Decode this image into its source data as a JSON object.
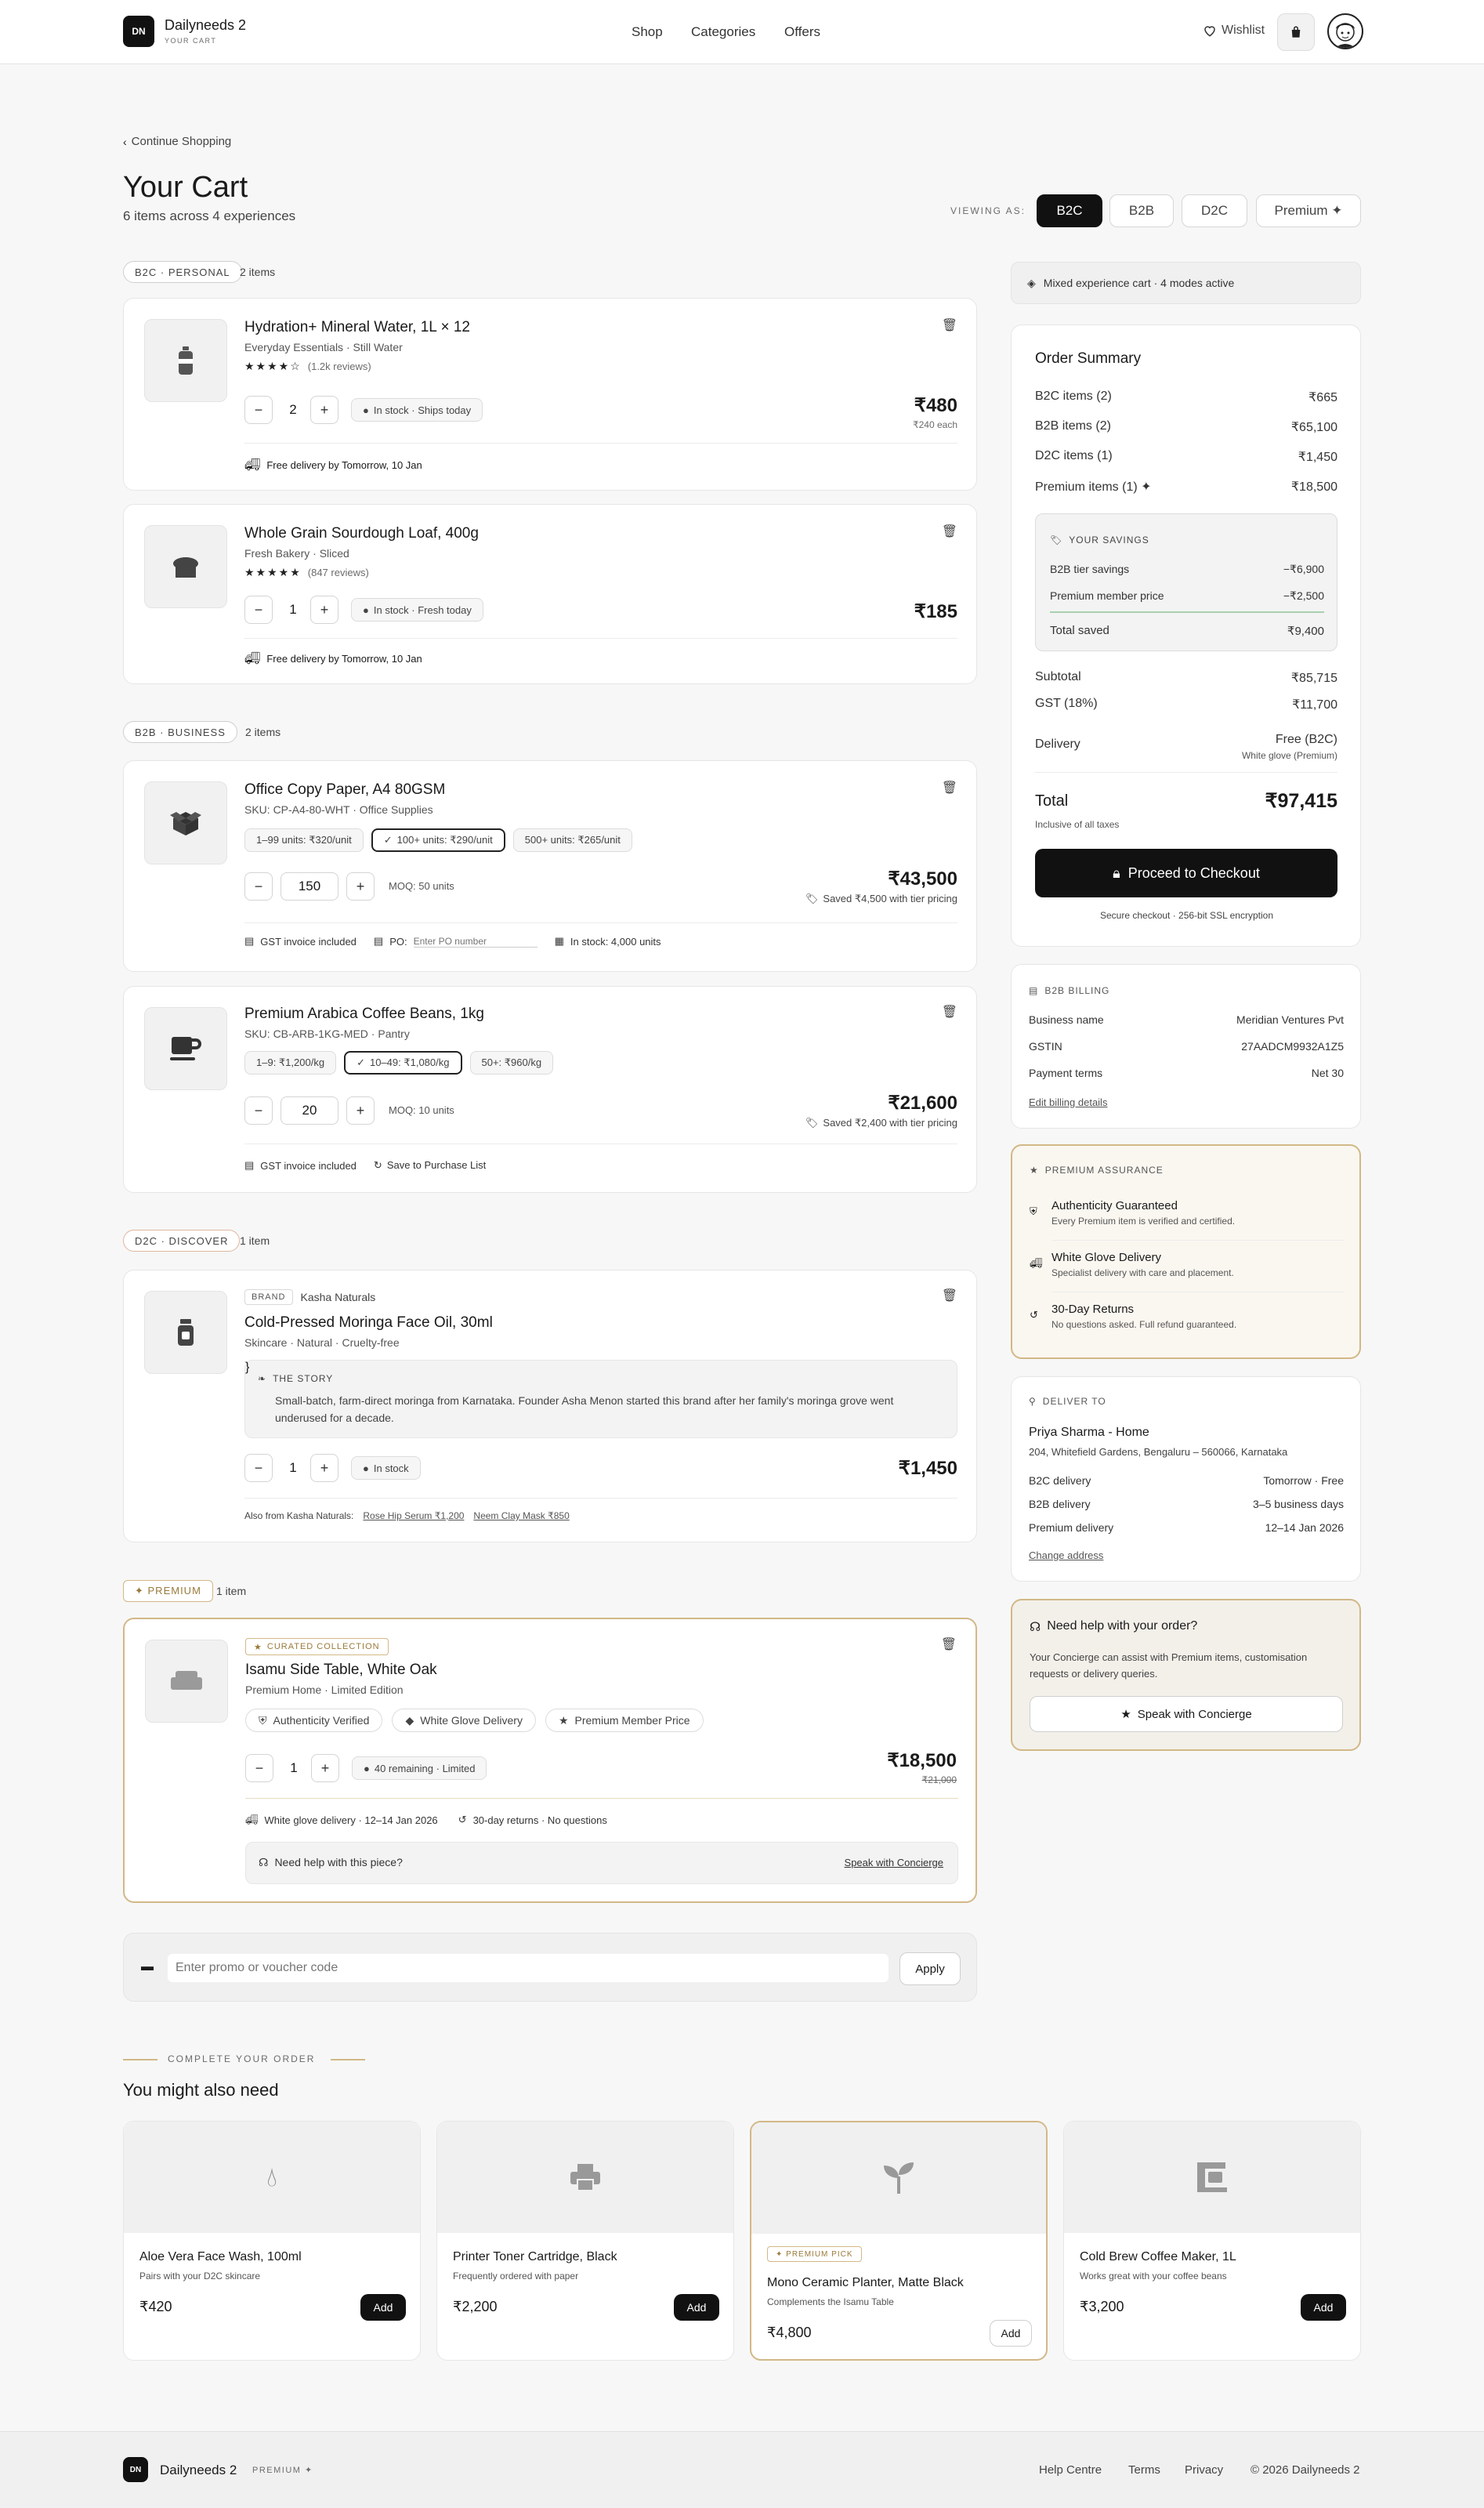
{
  "brand": {
    "initials": "DN",
    "name": "Dailyneeds 2",
    "sub": "YOUR CART"
  },
  "nav": [
    "Shop",
    "Categories",
    "Offers"
  ],
  "header": {
    "wishlist": "Wishlist"
  },
  "back": "Continue Shopping",
  "page": {
    "title": "Your Cart",
    "subtitle": "6 items across 4 experiences"
  },
  "viewing": {
    "label": "VIEWING AS:",
    "modes": [
      "B2C",
      "B2B",
      "D2C",
      "Premium ✦"
    ],
    "active": "B2C"
  },
  "sections": {
    "b2c": {
      "tag": "B2C · PERSONAL",
      "count": "2 items"
    },
    "b2b": {
      "tag": "B2B · BUSINESS",
      "count": "2 items"
    },
    "d2c": {
      "tag": "D2C · DISCOVER",
      "count": "1 item"
    },
    "prem": {
      "tag": "✦ PREMIUM",
      "count": "1 item"
    }
  },
  "items": {
    "water": {
      "name": "Hydration+ Mineral Water, 1L × 12",
      "meta": "Everyday Essentials · Still Water",
      "stars": "★★★★☆",
      "reviews": "(1.2k reviews)",
      "qty": "2",
      "stock": "In stock · Ships today",
      "price": "₹480",
      "unit": "₹240 each",
      "delivery": "Free delivery by Tomorrow, 10 Jan"
    },
    "bread": {
      "name": "Whole Grain Sourdough Loaf, 400g",
      "meta": "Fresh Bakery · Sliced",
      "stars": "★★★★★",
      "reviews": "(847 reviews)",
      "qty": "1",
      "stock": "In stock · Fresh today",
      "price": "₹185",
      "delivery": "Free delivery by Tomorrow, 10 Jan"
    },
    "paper": {
      "name": "Office Copy Paper, A4 80GSM",
      "meta": "SKU: CP-A4-80-WHT · Office Supplies",
      "tiers": [
        "1–99 units: ₹320/unit",
        "100+ units: ₹290/unit",
        "500+ units: ₹265/unit"
      ],
      "qty": "150",
      "moq": "MOQ: 50 units",
      "price": "₹43,500",
      "saved": "Saved ₹4,500 with tier pricing",
      "gst": "GST invoice included",
      "po_label": "PO:",
      "po_placeholder": "Enter PO number",
      "instock": "In stock: 4,000 units"
    },
    "coffee": {
      "name": "Premium Arabica Coffee Beans, 1kg",
      "meta": "SKU: CB-ARB-1KG-MED · Pantry",
      "tiers": [
        "1–9: ₹1,200/kg",
        "10–49: ₹1,080/kg",
        "50+: ₹960/kg"
      ],
      "qty": "20",
      "moq": "MOQ: 10 units",
      "price": "₹21,600",
      "saved": "Saved ₹2,400 with tier pricing",
      "gst": "GST invoice included",
      "save_list": "Save to Purchase List"
    },
    "oil": {
      "brand_tag": "BRAND",
      "brand": "Kasha Naturals",
      "name": "Cold-Pressed Moringa Face Oil, 30ml",
      "meta": "Skincare · Natural · Cruelty-free",
      "story_title": "THE STORY",
      "story": "Small-batch, farm-direct moringa from Karnataka. Founder Asha Menon started this brand after her family's moringa grove went underused for a decade.",
      "qty": "1",
      "stock": "In stock",
      "price": "₹1,450",
      "also_label": "Also from Kasha Naturals:",
      "also": [
        "Rose Hip Serum ₹1,200",
        "Neem Clay Mask ₹850"
      ]
    },
    "table": {
      "curated": "CURATED COLLECTION",
      "name": "Isamu Side Table, White Oak",
      "meta": "Premium Home · Limited Edition",
      "badges": [
        "Authenticity Verified",
        "White Glove Delivery",
        "Premium Member Price"
      ],
      "qty": "1",
      "stock": "40 remaining · Limited",
      "price": "₹18,500",
      "old_price": "₹21,000",
      "delivery": "White glove delivery · 12–14 Jan 2026",
      "returns": "30-day returns · No questions",
      "help": "Need help with this piece?",
      "help_link": "Speak with Concierge"
    }
  },
  "promo": {
    "placeholder": "Enter promo or voucher code",
    "apply": "Apply"
  },
  "recs": {
    "eyebrow": "COMPLETE YOUR ORDER",
    "title": "You might also need",
    "add": "Add",
    "pick": "✦ PREMIUM PICK",
    "items": [
      {
        "name": "Aloe Vera Face Wash, 100ml",
        "sub": "Pairs with your D2C skincare",
        "price": "₹420"
      },
      {
        "name": "Printer Toner Cartridge, Black",
        "sub": "Frequently ordered with paper",
        "price": "₹2,200"
      },
      {
        "name": "Mono Ceramic Planter, Matte Black",
        "sub": "Complements the Isamu Table",
        "price": "₹4,800"
      },
      {
        "name": "Cold Brew Coffee Maker, 1L",
        "sub": "Works great with your coffee beans",
        "price": "₹3,200"
      }
    ]
  },
  "mixed": "Mixed experience cart · 4 modes active",
  "summary": {
    "title": "Order Summary",
    "rows": [
      [
        "B2C items (2)",
        "₹665"
      ],
      [
        "B2B items (2)",
        "₹65,100"
      ],
      [
        "D2C items (1)",
        "₹1,450"
      ],
      [
        "Premium items (1) ✦",
        "₹18,500"
      ]
    ],
    "savings_title": "YOUR SAVINGS",
    "savings": [
      [
        "B2B tier savings",
        "−₹6,900"
      ],
      [
        "Premium member price",
        "−₹2,500"
      ]
    ],
    "total_saved": [
      "Total saved",
      "₹9,400"
    ],
    "subtotal": [
      "Subtotal",
      "₹85,715"
    ],
    "gst": [
      "GST (18%)",
      "₹11,700"
    ],
    "delivery": [
      "Delivery",
      "Free (B2C)",
      "White glove (Premium)"
    ],
    "total": [
      "Total",
      "₹97,415"
    ],
    "taxes": "Inclusive of all taxes",
    "checkout": "Proceed to Checkout",
    "secure": "Secure checkout · 256-bit SSL encryption"
  },
  "billing": {
    "title": "B2B BILLING",
    "rows": [
      [
        "Business name",
        "Meridian Ventures Pvt"
      ],
      [
        "GSTIN",
        "27AADCM9932A1Z5"
      ],
      [
        "Payment terms",
        "Net 30"
      ]
    ],
    "edit": "Edit billing details"
  },
  "assurance": {
    "title": "PREMIUM ASSURANCE",
    "items": [
      [
        "Authenticity Guaranteed",
        "Every Premium item is verified and certified."
      ],
      [
        "White Glove Delivery",
        "Specialist delivery with care and placement."
      ],
      [
        "30-Day Returns",
        "No questions asked. Full refund guaranteed."
      ]
    ]
  },
  "deliver": {
    "title": "DELIVER TO",
    "name": "Priya Sharma - Home",
    "addr": "204, Whitefield Gardens, Bengaluru – 560066, Karnataka",
    "rows": [
      [
        "B2C delivery",
        "Tomorrow · Free"
      ],
      [
        "B2B delivery",
        "3–5 business days"
      ],
      [
        "Premium delivery",
        "12–14 Jan 2026"
      ]
    ],
    "change": "Change address"
  },
  "help": {
    "title": "Need help with your order?",
    "text": "Your Concierge can assist with Premium items, customisation requests or delivery queries.",
    "btn": "Speak with Concierge"
  },
  "footer": {
    "name": "Dailyneeds 2",
    "badge": "PREMIUM ✦",
    "links": [
      "Help Centre",
      "Terms",
      "Privacy"
    ],
    "copy": "© 2026 Dailyneeds 2"
  },
  "colors": {
    "accent": "#111111",
    "premium": "#d2b887",
    "bg": "#f7f7f7"
  }
}
